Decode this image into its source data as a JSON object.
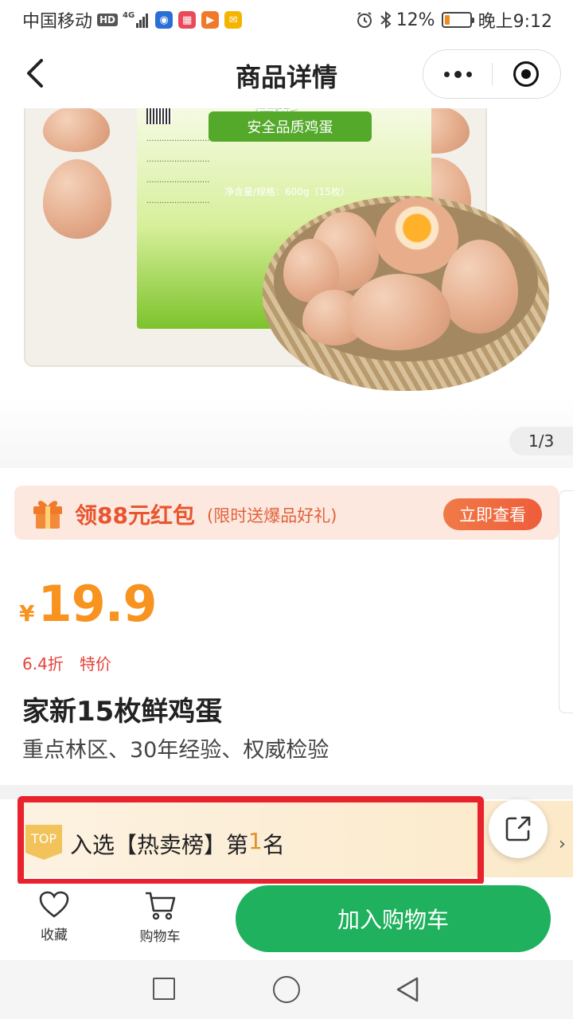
{
  "status_bar": {
    "carrier": "中国移动",
    "hd_badge": "HD",
    "network": "4G",
    "battery_percent": "12%",
    "time": "晚上9:12",
    "battery_level": 0.12
  },
  "nav": {
    "title": "商品详情"
  },
  "gallery": {
    "counter": "1/3",
    "package_brand": "家新",
    "package_badge": "安全品质鸡蛋",
    "package_spec": "净含量/规格：600g（15枚）"
  },
  "coupon": {
    "title": "领88元红包",
    "subtitle": "(限时送爆品好礼)",
    "button": "立即查看"
  },
  "product": {
    "currency": "¥",
    "price": "19.9",
    "discount": "6.4折",
    "tag": "特价",
    "name": "家新15枚鲜鸡蛋",
    "description": "重点林区、30年经验、权威检验"
  },
  "ranking": {
    "badge": "TOP",
    "text_before": "入选【热卖榜】第",
    "rank": "1",
    "text_after": "名",
    "chevron": "›"
  },
  "actions": {
    "favorite": "收藏",
    "cart": "购物车",
    "add_to_cart": "加入购物车"
  },
  "colors": {
    "price": "#f7931e",
    "accent_green": "#1fb15d",
    "highlight_red": "#e8232d",
    "coupon_orange": "#ee5d3a"
  }
}
